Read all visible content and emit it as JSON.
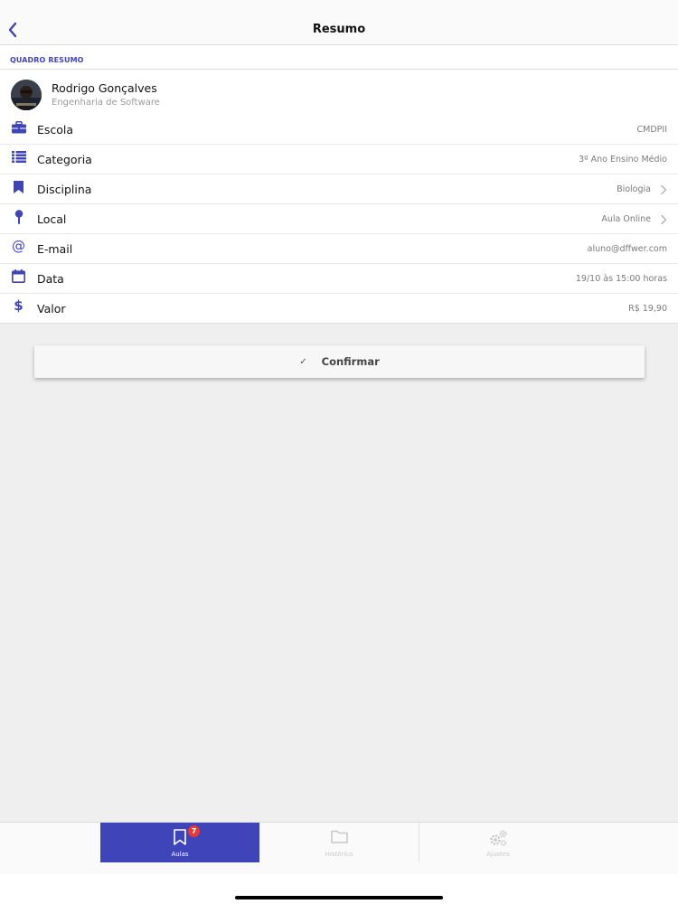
{
  "header": {
    "title": "Resumo",
    "back_icon": "chevron-left-icon"
  },
  "section": {
    "label": "QUADRO RESUMO"
  },
  "profile": {
    "name": "Rodrigo Gonçalves",
    "subtitle": "Engenharia de Software"
  },
  "rows": [
    {
      "label": "Escola",
      "value": "CMDPII",
      "icon": "briefcase-icon"
    },
    {
      "label": "Categoria",
      "value": "3º Ano Ensino Médio",
      "icon": "list-icon"
    },
    {
      "label": "Disciplina",
      "value": "Biologia",
      "icon": "bookmark-icon"
    },
    {
      "label": "Local",
      "value": "Aula Online",
      "icon": "pin-icon"
    },
    {
      "label": "E-mail",
      "value": "aluno@dffwer.com",
      "icon": "at-icon"
    },
    {
      "label": "Data",
      "value": "19/10 às 15:00 horas",
      "icon": "calendar-icon"
    },
    {
      "label": "Valor",
      "value": "R$ 19,90",
      "icon": "dollar-icon"
    }
  ],
  "confirm": {
    "label": "Confirmar",
    "icon": "checkmark-icon"
  },
  "tabs": [
    {
      "label": "Aulas",
      "badge": "7",
      "active": true,
      "icon": "bookmark-icon"
    },
    {
      "label": "Histórico",
      "active": false,
      "icon": "folder-icon"
    },
    {
      "label": "Ajustes",
      "active": false,
      "icon": "gears-icon"
    }
  ],
  "colors": {
    "accent": "#3f44b8",
    "badge": "#e53935",
    "background": "#efefef"
  }
}
